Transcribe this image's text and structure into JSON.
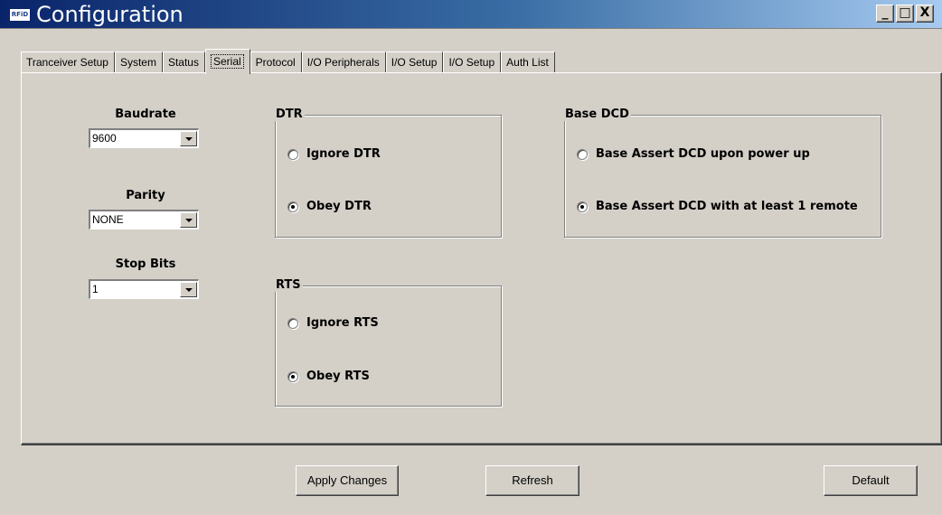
{
  "window": {
    "title": "Configuration",
    "icon_text": "RFiD",
    "controls": {
      "minimize": "_",
      "maximize": "□",
      "close": "X"
    }
  },
  "tabs": [
    {
      "label": "Tranceiver Setup",
      "active": false
    },
    {
      "label": "System",
      "active": false
    },
    {
      "label": "Status",
      "active": false
    },
    {
      "label": "Serial",
      "active": true
    },
    {
      "label": "Protocol",
      "active": false
    },
    {
      "label": "I/O Peripherals",
      "active": false
    },
    {
      "label": "I/O Setup",
      "active": false
    },
    {
      "label": "I/O Setup",
      "active": false
    },
    {
      "label": "Auth List",
      "active": false
    }
  ],
  "serial": {
    "baudrate": {
      "label": "Baudrate",
      "value": "9600"
    },
    "parity": {
      "label": "Parity",
      "value": "NONE"
    },
    "stop_bits": {
      "label": "Stop Bits",
      "value": "1"
    }
  },
  "dtr": {
    "title": "DTR",
    "options": [
      {
        "label": "Ignore DTR",
        "checked": false
      },
      {
        "label": "Obey DTR",
        "checked": true
      }
    ]
  },
  "rts": {
    "title": "RTS",
    "options": [
      {
        "label": "Ignore RTS",
        "checked": false
      },
      {
        "label": "Obey RTS",
        "checked": true
      }
    ]
  },
  "base_dcd": {
    "title": "Base DCD",
    "options": [
      {
        "label": "Base Assert DCD upon power up",
        "checked": false
      },
      {
        "label": "Base Assert DCD with at least 1 remote",
        "checked": true
      }
    ]
  },
  "buttons": {
    "apply": "Apply Changes",
    "refresh": "Refresh",
    "default": "Default"
  },
  "colors": {
    "window_bg": "#d4d0c8",
    "titlebar_start": "#0a246a",
    "titlebar_end": "#a6caf0",
    "title_text": "#ffffff"
  }
}
